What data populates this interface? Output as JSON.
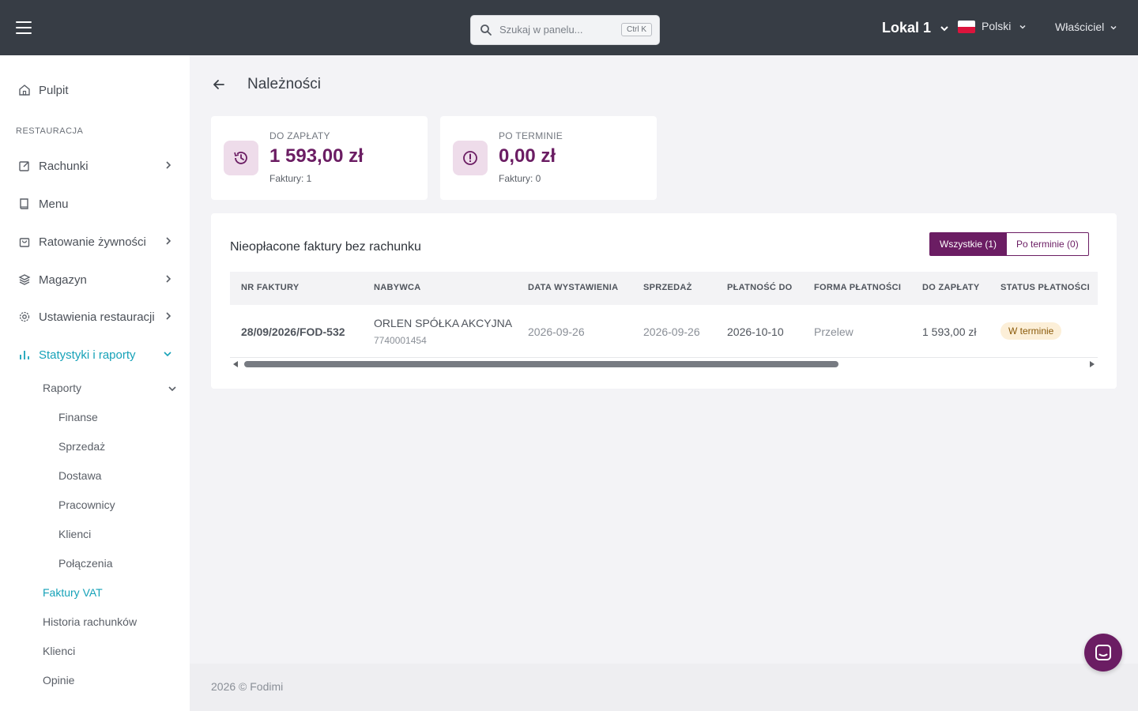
{
  "topbar": {
    "search_placeholder": "Szukaj w panelu...",
    "search_shortcut": "Ctrl K",
    "location": "Lokal 1",
    "language": "Polski",
    "role": "Właściciel"
  },
  "sidebar": {
    "dashboard": "Pulpit",
    "section_restaurant": "RESTAURACJA",
    "items": [
      {
        "label": "Rachunki"
      },
      {
        "label": "Menu"
      },
      {
        "label": "Ratowanie żywności"
      },
      {
        "label": "Magazyn"
      },
      {
        "label": "Ustawienia restauracji"
      },
      {
        "label": "Statystyki i raporty"
      }
    ],
    "reports": "Raporty",
    "reports_children": [
      "Finanse",
      "Sprzedaż",
      "Dostawa",
      "Pracownicy",
      "Klienci",
      "Połączenia"
    ],
    "vat_invoices": "Faktury VAT",
    "bill_history": "Historia rachunków",
    "clients": "Klienci",
    "reviews": "Opinie"
  },
  "page": {
    "title": "Należności"
  },
  "stats": [
    {
      "label": "DO ZAPŁATY",
      "value": "1 593,00 zł",
      "sub": "Faktury: 1"
    },
    {
      "label": "PO TERMINIE",
      "value": "0,00 zł",
      "sub": "Faktury: 0"
    }
  ],
  "card": {
    "title": "Nieopłacone faktury bez rachunku",
    "filter_all": "Wszystkie (1)",
    "filter_overdue": "Po terminie (0)"
  },
  "table": {
    "headers": [
      "NR FAKTURY",
      "NABYWCA",
      "DATA WYSTAWIENIA",
      "SPRZEDAŻ",
      "PŁATNOŚĆ DO",
      "FORMA PŁATNOŚCI",
      "DO ZAPŁATY",
      "STATUS PŁATNOŚCI"
    ],
    "rows": [
      {
        "invoice_no": "28/09/2026/FOD-532",
        "buyer": "ORLEN SPÓŁKA AKCYJNA",
        "buyer_nip": "7740001454",
        "issue_date": "2026-09-26",
        "sale_date": "2026-09-26",
        "due_date": "2026-10-10",
        "payment_method": "Przelew",
        "amount": "1 593,00 zł",
        "status": "W terminie"
      }
    ]
  },
  "footer": {
    "text": "2026 © Fodimi"
  },
  "colors": {
    "topbar": "#373d45",
    "brand": "#6b1d63",
    "active": "#16a2b8",
    "badge_bg": "#fcefd8"
  }
}
